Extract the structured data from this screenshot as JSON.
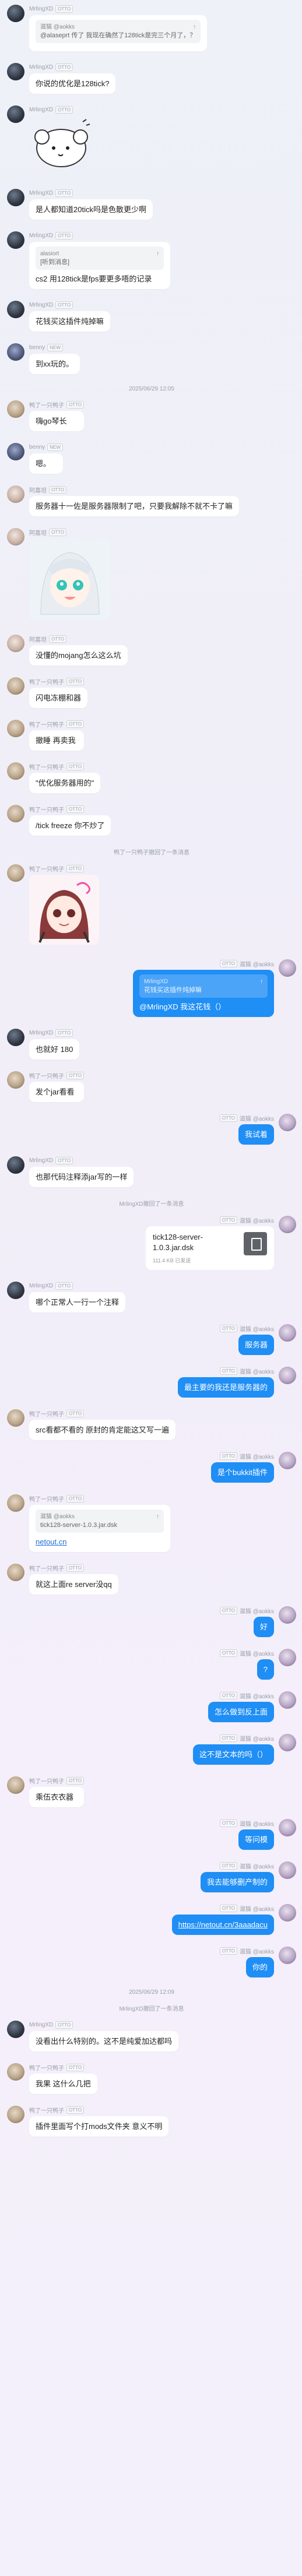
{
  "messages": [
    {
      "type": "in",
      "avatar": "mr",
      "name": "MrlingXD",
      "tag": "OTTO",
      "quote": {
        "name": "滋猫 @aokks",
        "text": "@alaseprt 传了 我现在确然了128tick是完三个月了，？"
      },
      "text": ""
    },
    {
      "type": "in",
      "avatar": "mr",
      "name": "MrlingXD",
      "tag": "OTTO",
      "text": "你说的优化是128tick?"
    },
    {
      "type": "in",
      "avatar": "mr",
      "name": "MrlingXD",
      "tag": "OTTO",
      "sticker": "sheep"
    },
    {
      "type": "in",
      "avatar": "mr",
      "name": "MrlingXD",
      "tag": "OTTO",
      "text": "是人都知道20tick吗是色散更少啊"
    },
    {
      "type": "in",
      "avatar": "mr",
      "name": "MrlingXD",
      "tag": "OTTO",
      "quote": {
        "name": "alasiort",
        "text": "[听到消息]"
      },
      "text": "cs2 用128tick是fps要更多唔的记录"
    },
    {
      "type": "in",
      "avatar": "mr",
      "name": "MrlingXD",
      "tag": "OTTO",
      "text": "花钱买这插件炖掉嘛"
    },
    {
      "type": "in",
      "avatar": "be",
      "name": "benny",
      "tag": "NEW",
      "text": "到xx玩的。"
    },
    {
      "type": "time",
      "text": "2025/06/29 12:05"
    },
    {
      "type": "in",
      "avatar": "ya",
      "name": "鸭了一只鸭子",
      "tag": "OTTO",
      "text": "嗨go琴长"
    },
    {
      "type": "in",
      "avatar": "be",
      "name": "benny",
      "tag": "NEW",
      "text": "嗯。"
    },
    {
      "type": "in",
      "avatar": "ao",
      "name": "阿嘉坦",
      "tag": "OTTO",
      "text": "服务器十一佐是服务器限制了吧，只要我解除不就不卡了嘛"
    },
    {
      "type": "in",
      "avatar": "ao",
      "name": "阿嘉坦",
      "tag": "OTTO",
      "sticker": "girl"
    },
    {
      "type": "in",
      "avatar": "ao",
      "name": "阿嘉坦",
      "tag": "OTTO",
      "text": "没懂的mojang怎么这么坑"
    },
    {
      "type": "in",
      "avatar": "ya",
      "name": "鸭了一只鸭子",
      "tag": "OTTO",
      "text": "闪电冻棚和器"
    },
    {
      "type": "in",
      "avatar": "ya",
      "name": "鸭了一只鸭子",
      "tag": "OTTO",
      "text": "撤睡 再卖我"
    },
    {
      "type": "in",
      "avatar": "ya",
      "name": "鸭了一只鸭子",
      "tag": "OTTO",
      "text": "\"优化服务器用的\""
    },
    {
      "type": "in",
      "avatar": "ya",
      "name": "鸭了一只鸭子",
      "tag": "OTTO",
      "text": "/tick freeze 你不炒了"
    },
    {
      "type": "time",
      "text": "鸭了一只鸭子撤回了一条消息"
    },
    {
      "type": "in",
      "avatar": "ya",
      "name": "鸭了一只鸭子",
      "tag": "OTTO",
      "sticker": "redgirl"
    },
    {
      "type": "out",
      "avatar": "me",
      "name": "滋猫 @aokks",
      "tag": "OTTO",
      "quote": {
        "name": "MrlingXD",
        "text": "花钱买这插件炖掉嘛"
      },
      "text": "@MrlingXD 我这花钱（）"
    },
    {
      "type": "in",
      "avatar": "mr",
      "name": "MrlingXD",
      "tag": "OTTO",
      "text": "也就好 180"
    },
    {
      "type": "in",
      "avatar": "ya",
      "name": "鸭了一只鸭子",
      "tag": "OTTO",
      "text": "发个jar看看"
    },
    {
      "type": "out",
      "avatar": "me",
      "name": "滋猫 @aokks",
      "tag": "OTTO",
      "text": "我试着"
    },
    {
      "type": "in",
      "avatar": "mr",
      "name": "MrlingXD",
      "tag": "OTTO",
      "text": "也那代码注释添jar写的一样"
    },
    {
      "type": "time",
      "text": "MrlingXD撤回了一条消息"
    },
    {
      "type": "outfile",
      "avatar": "me",
      "name": "滋猫 @aokks",
      "tag": "OTTO",
      "file": {
        "name": "tick128-server-1.0.3.jar.dsk",
        "size": "111.4 KB  已发送"
      }
    },
    {
      "type": "in",
      "avatar": "mr",
      "name": "MrlingXD",
      "tag": "OTTO",
      "text": "哪个正常人一行一个注释"
    },
    {
      "type": "out",
      "avatar": "me",
      "name": "滋猫 @aokks",
      "tag": "OTTO",
      "text": "服务器"
    },
    {
      "type": "out",
      "avatar": "me",
      "name": "滋猫 @aokks",
      "tag": "OTTO",
      "text": "最主要的我还是服务器的"
    },
    {
      "type": "in",
      "avatar": "ya",
      "name": "鸭了一只鸭子",
      "tag": "OTTO",
      "text": "src看都不看的 原封的肯定能这又写一遍"
    },
    {
      "type": "out",
      "avatar": "me",
      "name": "滋猫 @aokks",
      "tag": "OTTO",
      "text": "是个bukkit插件"
    },
    {
      "type": "in",
      "avatar": "ya",
      "name": "鸭了一只鸭子",
      "tag": "OTTO",
      "quote": {
        "name": "滋猫 @aokks",
        "text": "tick128-server-1.0.3.jar.dsk"
      },
      "link": "netout.cn"
    },
    {
      "type": "in",
      "avatar": "ya",
      "name": "鸭了一只鸭子",
      "tag": "OTTO",
      "text": "就这上面re server没qq"
    },
    {
      "type": "out",
      "avatar": "me",
      "name": "滋猫 @aokks",
      "tag": "OTTO",
      "text": "好"
    },
    {
      "type": "out",
      "avatar": "me",
      "name": "滋猫 @aokks",
      "tag": "OTTO",
      "text": "?"
    },
    {
      "type": "out",
      "avatar": "me",
      "name": "滋猫 @aokks",
      "tag": "OTTO",
      "text": "怎么做到反上面"
    },
    {
      "type": "out",
      "avatar": "me",
      "name": "滋猫 @aokks",
      "tag": "OTTO",
      "text": "这不是文本的吗（）"
    },
    {
      "type": "in",
      "avatar": "ya",
      "name": "鸭了一只鸭子",
      "tag": "OTTO",
      "text": "乘伍衣衣器"
    },
    {
      "type": "out",
      "avatar": "me",
      "name": "滋猫 @aokks",
      "tag": "OTTO",
      "text": "等问模"
    },
    {
      "type": "out",
      "avatar": "me",
      "name": "滋猫 @aokks",
      "tag": "OTTO",
      "text": "我去能够删产制的"
    },
    {
      "type": "out",
      "avatar": "me",
      "name": "滋猫 @aokks",
      "tag": "OTTO",
      "link": "https://netout.cn/3aaadacu"
    },
    {
      "type": "out",
      "avatar": "me",
      "name": "滋猫 @aokks",
      "tag": "OTTO",
      "text": "你的"
    },
    {
      "type": "time",
      "text": "2025/06/29 12:09"
    },
    {
      "type": "time",
      "text": "MrlingXD撤回了一条消息"
    },
    {
      "type": "in",
      "avatar": "mr",
      "name": "MrlingXD",
      "tag": "OTTO",
      "text": "没看出什么特别的。这不是纯爱加达都吗"
    },
    {
      "type": "in",
      "avatar": "ya",
      "name": "鸭了一只鸭子",
      "tag": "OTTO",
      "text": "我果 这什么几把"
    },
    {
      "type": "in",
      "avatar": "ya",
      "name": "鸭了一只鸭子",
      "tag": "OTTO",
      "text": "插件里面写个打mods文件夹 意义不明"
    }
  ]
}
